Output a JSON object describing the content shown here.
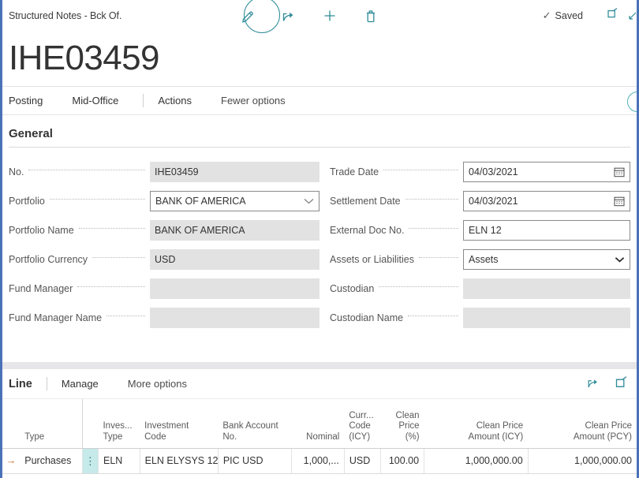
{
  "topbar": {
    "breadcrumb": "Structured Notes - Bck Of.",
    "icons": [
      {
        "name": "edit-pencil-icon",
        "label": "Edit"
      },
      {
        "name": "share-icon",
        "label": "Share"
      },
      {
        "name": "plus-icon",
        "label": "New"
      },
      {
        "name": "trash-icon",
        "label": "Delete"
      }
    ],
    "status": "Saved",
    "open_new_window_label": "Open in new window"
  },
  "page": {
    "title": "IHE03459"
  },
  "ribbon": {
    "items": [
      {
        "label": "Posting"
      },
      {
        "label": "Mid-Office"
      },
      {
        "label": "Actions"
      },
      {
        "label": "Fewer options"
      }
    ]
  },
  "general": {
    "heading": "General",
    "left_fields": [
      {
        "label": "No.",
        "value": "IHE03459",
        "type": "readonly"
      },
      {
        "label": "Portfolio",
        "value": "BANK OF AMERICA",
        "type": "select"
      },
      {
        "label": "Portfolio Name",
        "value": "BANK OF AMERICA",
        "type": "readonly"
      },
      {
        "label": "Portfolio Currency",
        "value": "USD",
        "type": "readonly"
      },
      {
        "label": "Fund Manager",
        "value": "",
        "type": "readonly"
      },
      {
        "label": "Fund Manager Name",
        "value": "",
        "type": "readonly"
      }
    ],
    "right_fields": [
      {
        "label": "Trade Date",
        "value": "04/03/2021",
        "type": "date"
      },
      {
        "label": "Settlement Date",
        "value": "04/03/2021",
        "type": "date"
      },
      {
        "label": "External Doc No.",
        "value": "ELN 12",
        "type": "input"
      },
      {
        "label": "Assets or Liabilities",
        "value": "Assets",
        "type": "select"
      },
      {
        "label": "Custodian",
        "value": "",
        "type": "readonly"
      },
      {
        "label": "Custodian Name",
        "value": "",
        "type": "readonly"
      }
    ]
  },
  "lines": {
    "title": "Line",
    "ribbon": [
      {
        "label": "Manage"
      },
      {
        "label": "More options"
      }
    ],
    "columns": [
      {
        "header": "",
        "align": "left"
      },
      {
        "header": "Type",
        "align": "left"
      },
      {
        "header": "",
        "align": "left"
      },
      {
        "header": "Inves...\nType",
        "align": "left"
      },
      {
        "header": "Investment\nCode",
        "align": "left"
      },
      {
        "header": "Bank Account\nNo.",
        "align": "left"
      },
      {
        "header": "Nominal",
        "align": "right"
      },
      {
        "header": "Curr...\nCode\n(ICY)",
        "align": "left"
      },
      {
        "header": "Clean\nPrice\n(%)",
        "align": "right"
      },
      {
        "header": "Clean Price\nAmount (ICY)",
        "align": "right"
      },
      {
        "header": "Clean Price\nAmount (PCY)",
        "align": "right"
      }
    ],
    "rows": [
      {
        "arrow": "→",
        "type": "Purchases",
        "dots": "⋮",
        "investment_type": "ELN",
        "investment_code": "ELN ELYSYS 12",
        "bank_account_no": "PIC USD",
        "nominal": "1,000,...",
        "currency_code_icy": "USD",
        "clean_price_pct": "100.00",
        "clean_price_amount_icy": "1,000,000.00",
        "clean_price_amount_pcy": "1,000,000.00"
      }
    ]
  },
  "colors": {
    "accent_teal": "#2e8b98",
    "window_border_blue": "#4a72b8",
    "selected_cell": "#c6e9ea",
    "readonly_field": "#e2e2e2"
  }
}
